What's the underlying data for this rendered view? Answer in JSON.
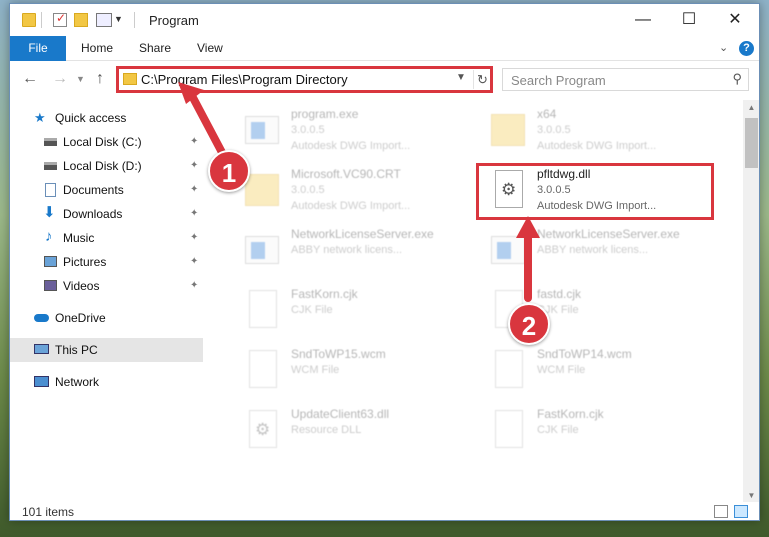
{
  "titlebar": {
    "title": "Program",
    "min_glyph": "—",
    "max_glyph": "☐",
    "close_glyph": "✕"
  },
  "ribbon": {
    "tabs": [
      "File",
      "Home",
      "Share",
      "View"
    ],
    "help_glyph": "?"
  },
  "navbar": {
    "address": "C:\\Program Files\\Program Directory",
    "search_placeholder": "Search Program"
  },
  "sidebar": {
    "items": [
      {
        "label": "Quick access",
        "icon": "star-icon",
        "pinned": false
      },
      {
        "label": "Local Disk (C:)",
        "icon": "drive-icon",
        "pinned": true
      },
      {
        "label": "Local Disk (D:)",
        "icon": "drive-icon",
        "pinned": true
      },
      {
        "label": "Documents",
        "icon": "documents-icon",
        "pinned": true
      },
      {
        "label": "Downloads",
        "icon": "download-icon",
        "pinned": true
      },
      {
        "label": "Music",
        "icon": "music-icon",
        "pinned": true
      },
      {
        "label": "Pictures",
        "icon": "pictures-icon",
        "pinned": true
      },
      {
        "label": "Videos",
        "icon": "videos-icon",
        "pinned": true
      },
      {
        "label": "OneDrive",
        "icon": "cloud-icon",
        "pinned": false
      },
      {
        "label": "This PC",
        "icon": "computer-icon",
        "pinned": false,
        "selected": true
      },
      {
        "label": "Network",
        "icon": "network-icon",
        "pinned": false
      }
    ]
  },
  "files": [
    {
      "name": "program.exe",
      "line2": "3.0.0.5",
      "line3": "Autodesk DWG Import...",
      "icon": "exe-icon",
      "faded": true
    },
    {
      "name": "x64",
      "line2": "3.0.0.5",
      "line3": "Autodesk DWG Import...",
      "icon": "folder-icon",
      "faded": true
    },
    {
      "name": "Microsoft.VC90.CRT",
      "line2": "3.0.0.5",
      "line3": "Autodesk DWG Import...",
      "icon": "folder-icon",
      "faded": true
    },
    {
      "name": "pfltdwg.dll",
      "line2": "3.0.0.5",
      "line3": "Autodesk DWG Import...",
      "icon": "dll-gear-icon",
      "faded": false
    },
    {
      "name": "NetworkLicenseServer.exe",
      "line2": "ABBY network licens...",
      "line3": "",
      "icon": "exe-icon",
      "faded": true
    },
    {
      "name": "NetworkLicenseServer.exe",
      "line2": "ABBY network licens...",
      "line3": "",
      "icon": "exe-icon",
      "faded": true
    },
    {
      "name": "FastKorn.cjk",
      "line2": "CJK File",
      "line3": "",
      "icon": "file-icon",
      "faded": true
    },
    {
      "name": "fastd.cjk",
      "line2": "CJK File",
      "line3": "",
      "icon": "file-icon",
      "faded": true
    },
    {
      "name": "SndToWP15.wcm",
      "line2": "WCM File",
      "line3": "",
      "icon": "file-icon",
      "faded": true
    },
    {
      "name": "SndToWP14.wcm",
      "line2": "WCM File",
      "line3": "",
      "icon": "file-icon",
      "faded": true
    },
    {
      "name": "UpdateClient63.dll",
      "line2": "Resource DLL",
      "line3": "",
      "icon": "dll-icon",
      "faded": true
    },
    {
      "name": "FastKorn.cjk",
      "line2": "CJK File",
      "line3": "",
      "icon": "file-icon",
      "faded": true
    }
  ],
  "status": {
    "item_count": "101 items"
  },
  "annotations": {
    "badge1": "1",
    "badge2": "2",
    "color": "#d9363e"
  }
}
